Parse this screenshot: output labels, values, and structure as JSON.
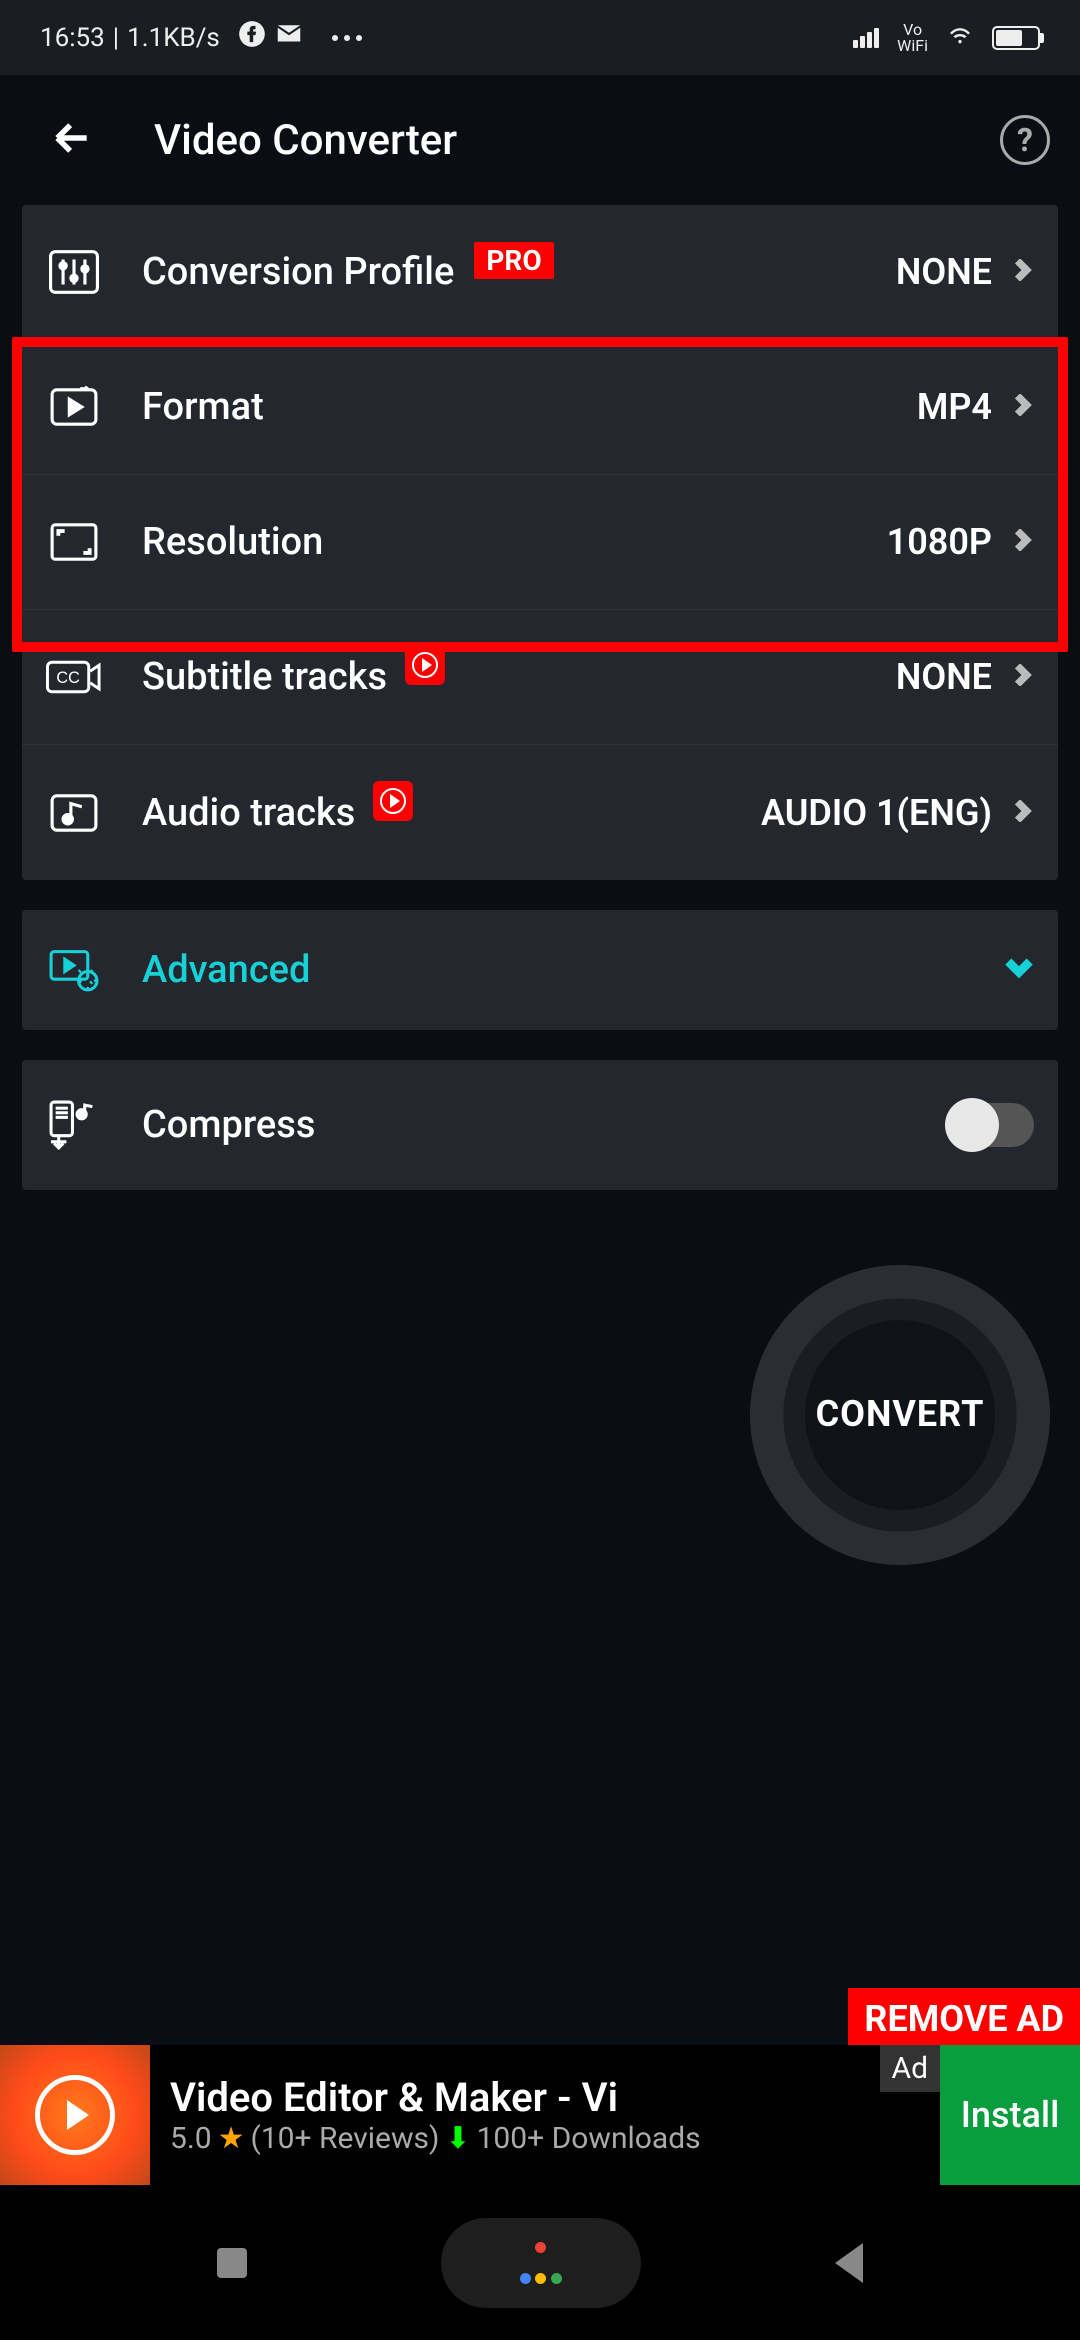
{
  "status": {
    "time": "16:53",
    "network_speed": "1.1KB/s",
    "vowifi_top": "Vo",
    "vowifi_bottom": "WiFi"
  },
  "appbar": {
    "title": "Video Converter"
  },
  "rows": {
    "profile": {
      "label": "Conversion Profile",
      "badge": "PRO",
      "value": "NONE"
    },
    "format": {
      "label": "Format",
      "value": "MP4"
    },
    "resolution": {
      "label": "Resolution",
      "value": "1080P"
    },
    "subtitle": {
      "label": "Subtitle tracks",
      "value": "NONE"
    },
    "audio": {
      "label": "Audio tracks",
      "value": "AUDIO 1(ENG)"
    },
    "advanced": {
      "label": "Advanced"
    },
    "compress": {
      "label": "Compress"
    }
  },
  "convert": {
    "label": "CONVERT"
  },
  "remove_ad": {
    "label": "REMOVE AD"
  },
  "ad": {
    "badge": "Ad",
    "title": "Video Editor & Maker - Vi",
    "rating": "5.0",
    "reviews": "(10+ Reviews)",
    "downloads": "100+ Downloads",
    "install": "Install"
  }
}
